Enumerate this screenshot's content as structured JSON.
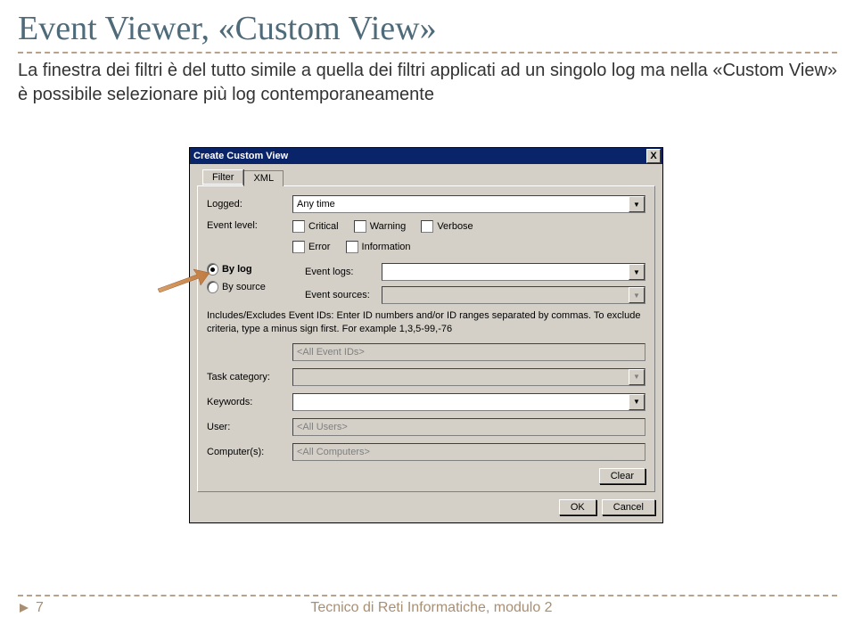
{
  "slide": {
    "title": "Event Viewer, «Custom View»",
    "description": "La finestra dei filtri è del tutto simile a quella dei filtri applicati ad un singolo log ma nella «Custom View» è possibile selezionare più log contemporaneamente",
    "page_number": "7",
    "footer": "Tecnico di Reti Informatiche, modulo 2"
  },
  "dialog": {
    "title": "Create Custom View",
    "close": "X",
    "tabs": {
      "filter": "Filter",
      "xml": "XML"
    },
    "logged_label": "Logged:",
    "logged_value": "Any time",
    "event_level_label": "Event level:",
    "levels": {
      "critical": "Critical",
      "warning": "Warning",
      "verbose": "Verbose",
      "error": "Error",
      "information": "Information"
    },
    "by_log": "By log",
    "by_source": "By source",
    "event_logs_label": "Event logs:",
    "event_sources_label": "Event sources:",
    "ids_help": "Includes/Excludes Event IDs: Enter ID numbers and/or ID ranges separated by commas. To exclude criteria, type a minus sign first. For example 1,3,5-99,-76",
    "ids_placeholder": "<All Event IDs>",
    "task_category_label": "Task category:",
    "keywords_label": "Keywords:",
    "user_label": "User:",
    "user_placeholder": "<All Users>",
    "computers_label": "Computer(s):",
    "computers_placeholder": "<All Computers>",
    "clear": "Clear",
    "ok": "OK",
    "cancel": "Cancel"
  }
}
